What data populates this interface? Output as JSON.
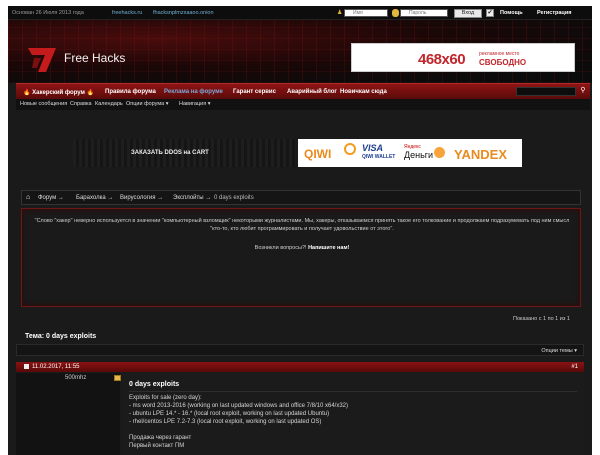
{
  "topbar": {
    "founded": "Основан 26 Июля 2013 года",
    "link1": "freehacks.ru",
    "link2": "fhacksnplmzxaaoo.onion",
    "login_placeholder": "Имя",
    "password_placeholder": "Пароль",
    "login_button": "Вход",
    "checkbox": "✔",
    "help": "Помощь",
    "register": "Регистрация"
  },
  "header": {
    "site_name": "Free Hacks",
    "ad": {
      "size": "468x60",
      "line1": "рекламное место",
      "line2": "СВОБОДНО"
    }
  },
  "mainnav": {
    "items": [
      "🔥 Хакерский форум 🔥",
      "Правила форума",
      "Реклама на форуме",
      "Гарант сервис",
      "Аварийный блог",
      "Новичкам сюда"
    ],
    "search_icon": "search-icon"
  },
  "subnav": {
    "items": [
      "Новые сообщения",
      "Справка",
      "Календарь",
      "Опции форума ▾",
      "Навигация ▾"
    ]
  },
  "banners": {
    "left_text": "ЗАКАЗАТЬ DDOS на CART",
    "qiwi": "QIWI",
    "visa": "VISA",
    "visa_sub": "QIWI WALLET",
    "yandex_small": "Яндекс",
    "yandex_money": "Деньги",
    "yandex": "YANDEX"
  },
  "breadcrumb": {
    "items": [
      "Форум →",
      "Барахолка →",
      "Вирусология →",
      "Эксплойты →",
      "0 days exploits"
    ]
  },
  "notice": {
    "text": "\"Слово \"хакер\" неверно используется в значении \"компьютерный взломщик\" некоторыми журналистами. Мы, хакеры, отказываемся принять такое его толкование и продолжаем подразумевать под ним смысл \"кто-то, кто любит программировать и получает удовольствие от этого\".",
    "question": "Возникли вопросы?!",
    "write_us": "Напишите нам!"
  },
  "pagination": "Показано с 1 по 1 из 1",
  "thread": {
    "title": "Тема: 0 days exploits",
    "tools": "Опции темы ▾"
  },
  "post": {
    "date": "11.02.2017, 11:55",
    "number": "#1",
    "username": "500mhz",
    "title": "0 days exploits",
    "lines": [
      "Exploits for sale (zero day):",
      "- ms word 2013-2016 (working on last updated windows and office 7/8/10 x64/x32)",
      "- ubuntu LPE 14.* - 16.* (local root exploit, working on last updated Ubuntu)",
      "- rhel/centos LPE 7.2-7.3 (local root exploit, working on last updated OS)",
      "",
      "Продажа через гарант",
      "Первый контакт ПМ"
    ]
  },
  "colors": {
    "accent": "#8f1414",
    "link": "#6fb2d6",
    "ad_red": "#c0262b"
  }
}
